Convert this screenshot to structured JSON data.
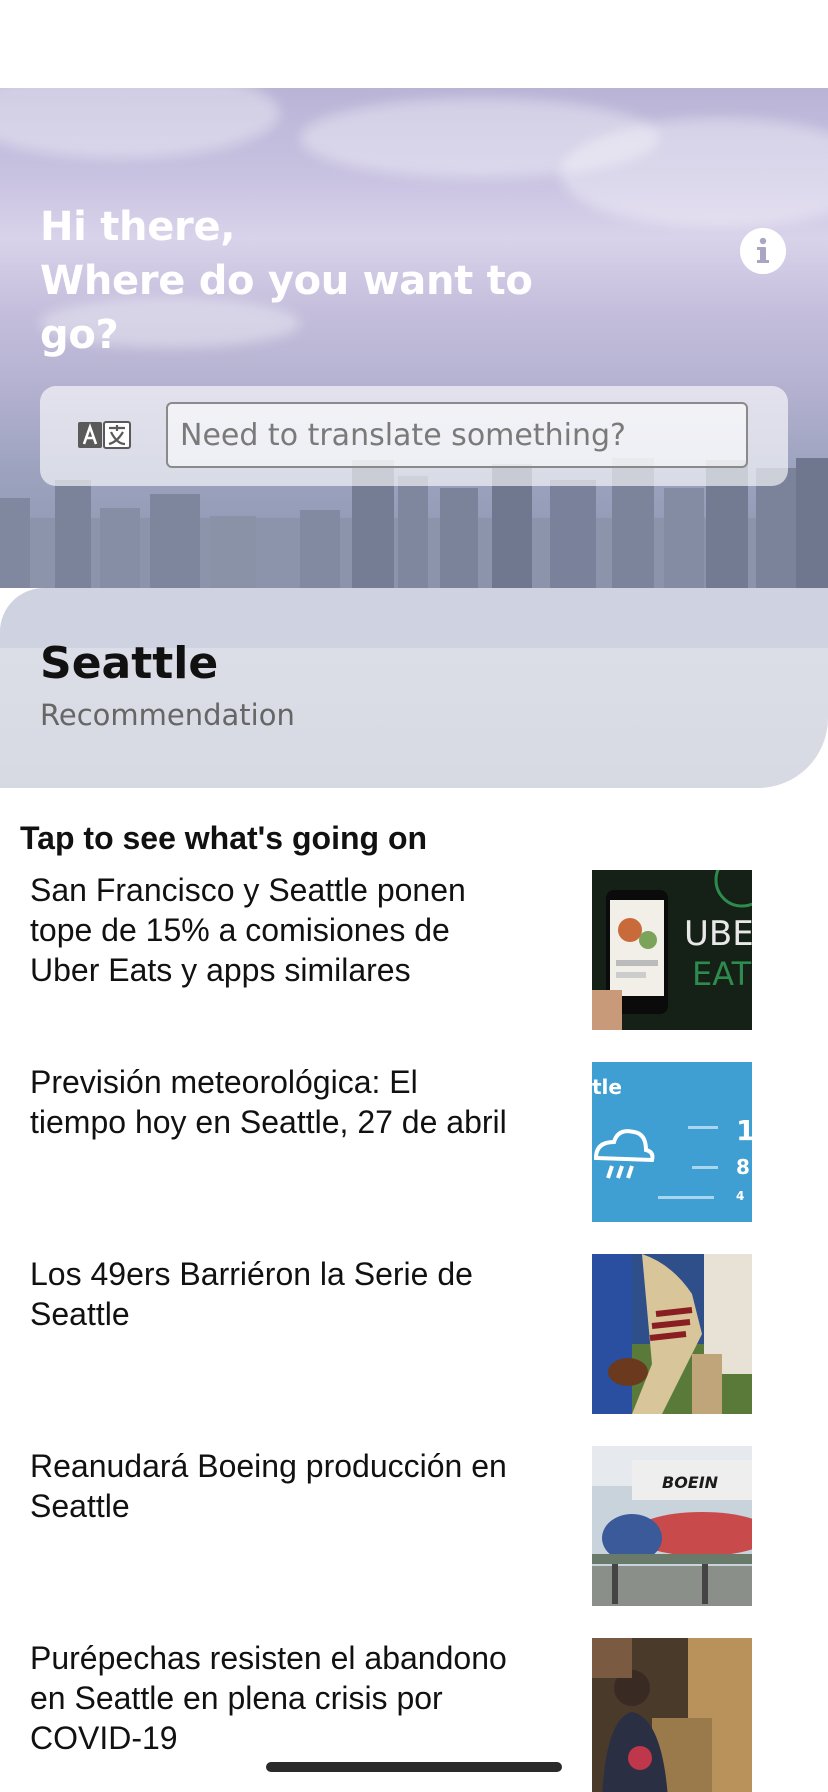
{
  "header": {
    "greeting_line1": "Hi there,",
    "greeting_line2": "Where do you want to go?"
  },
  "translate": {
    "placeholder": "Need to translate something?",
    "icon": "translate-icon"
  },
  "city": {
    "name": "Seattle",
    "subtitle": "Recommendation"
  },
  "news": {
    "section_title": "Tap to see what's going on",
    "items": [
      {
        "title": "San Francisco y Seattle ponen tope de 15% a comisiones de Uber Eats y apps similares",
        "thumb": "uber-eats-phone"
      },
      {
        "title": "Previsión meteorológica: El tiempo hoy en Seattle, 27 de abril",
        "thumb": "weather-forecast"
      },
      {
        "title": "Los 49ers Barriéron la Serie de Seattle",
        "thumb": "football-player"
      },
      {
        "title": "Reanudará Boeing producción en Seattle",
        "thumb": "boeing-plant"
      },
      {
        "title": "Purépechas resisten el abandono en Seattle en plena crisis por COVID-19",
        "thumb": "worker-boxes"
      }
    ]
  },
  "thumb_texts": {
    "uber": "UBE",
    "eats": "EATS",
    "weather_title": "tle",
    "weather_val1": "1",
    "weather_val2": "8",
    "weather_val3": "4",
    "boeing": "BOEIN"
  },
  "colors": {
    "sky_top": "#b9b3d6",
    "card_bg": "#d6d8e2",
    "accent_text": "#111111",
    "subtitle_text": "#666666",
    "weather_blue": "#3f9fd2"
  }
}
